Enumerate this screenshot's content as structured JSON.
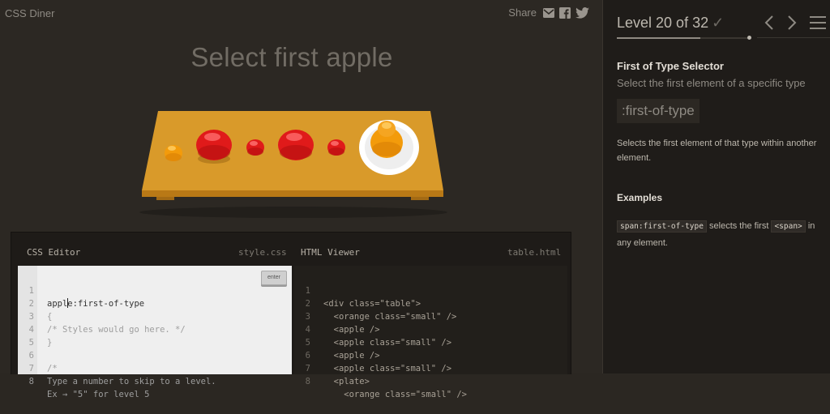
{
  "app": {
    "logo": "CSS Diner"
  },
  "share": {
    "label": "Share",
    "icons": [
      "email-icon",
      "facebook-icon",
      "twitter-icon"
    ]
  },
  "instruction": "Select first apple",
  "level": {
    "title": "Level 20 of 32",
    "completed_icon": "check-icon",
    "current": 20,
    "total": 32,
    "progress": 0.625
  },
  "sidebar": {
    "selector_name": "First of Type Selector",
    "syntax": "Select the first element of a specific type",
    "syntax_code": ":first-of-type",
    "description": "Selects the first element of that type within another element.",
    "examples_heading": "Examples",
    "example": {
      "code": "span:first-of-type",
      "text_mid": "selects the first",
      "tag": "<span>",
      "text_end": "in any element."
    }
  },
  "editor": {
    "css_label": "CSS Editor",
    "css_file": "style.css",
    "html_label": "HTML Viewer",
    "html_file": "table.html",
    "enter_label": "enter",
    "css_input_before": "appl",
    "css_input_after": "e:first-of-type",
    "css_lines": [
      "{",
      "/* Styles would go here. */",
      "}",
      "",
      "/*",
      "Type a number to skip to a level.",
      "Ex → \"5\" for level 5"
    ],
    "css_line_numbers": [
      "1",
      "2",
      "3",
      "4",
      "5",
      "6",
      "7",
      "8"
    ],
    "html_lines": [
      "<div class=\"table\">",
      "  <orange class=\"small\" />",
      "  <apple />",
      "  <apple class=\"small\" />",
      "  <apple />",
      "  <apple class=\"small\" />",
      "  <plate>",
      "    <orange class=\"small\" />"
    ],
    "html_line_numbers": [
      "1",
      "2",
      "3",
      "4",
      "5",
      "6",
      "7",
      "8"
    ]
  },
  "colors": {
    "background": "#2c2823",
    "sidebar": "#1f1c19",
    "table": "#d99a2a",
    "apple": "#e01a1a",
    "orange": "#f39b0b",
    "plate": "#ffffff"
  }
}
